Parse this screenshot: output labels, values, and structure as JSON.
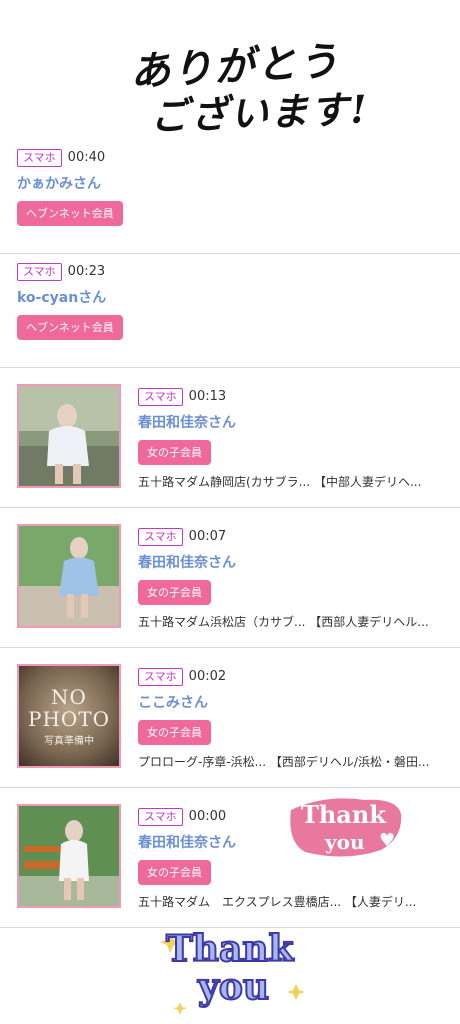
{
  "header": {
    "thanks_line1": "ありがとう",
    "thanks_line2": "ございます!"
  },
  "rows": [
    {
      "badge": "スマホ",
      "time": "00:40",
      "name": "かぁかみさん",
      "member": "ヘブンネット会員"
    },
    {
      "badge": "スマホ",
      "time": "00:23",
      "name": "ko-cyanさん",
      "member": "ヘブンネット会員"
    },
    {
      "badge": "スマホ",
      "time": "00:13",
      "name": "春田和佳奈さん",
      "member": "女の子会員",
      "shop": "五十路マダム静岡店(カサブラ... 【中部人妻デリヘ..."
    },
    {
      "badge": "スマホ",
      "time": "00:07",
      "name": "春田和佳奈さん",
      "member": "女の子会員",
      "shop": "五十路マダム浜松店（カサブ... 【西部人妻デリヘル..."
    },
    {
      "badge": "スマホ",
      "time": "00:02",
      "name": "ここみさん",
      "member": "女の子会員",
      "shop": "プロローグ-序章-浜松... 【西部デリヘル/浜松・磐田..."
    },
    {
      "badge": "スマホ",
      "time": "00:00",
      "name": "春田和佳奈さん",
      "member": "女の子会員",
      "shop": "五十路マダム　エクスプレス豊橋店... 【人妻デリ..."
    }
  ],
  "nophoto": {
    "line1": "NO",
    "line2": "PHOTO",
    "line3": "写真準備中"
  },
  "stickers": {
    "thank_you_1a": "Thank",
    "thank_you_1b": "you",
    "thank_you_2a": "Thank",
    "thank_you_2b": "you"
  },
  "colors": {
    "badge": "#c536c8",
    "name": "#6a8fd4",
    "member_button": "#ef6a9a",
    "thumb_border": "#f09ab8"
  }
}
